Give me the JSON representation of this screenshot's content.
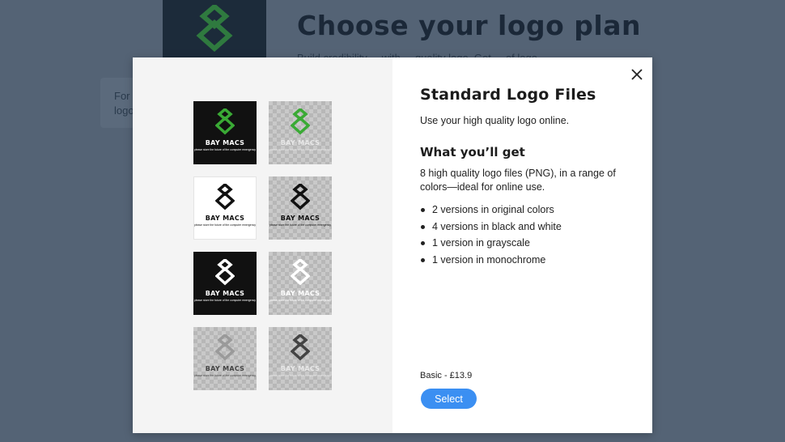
{
  "page": {
    "title": "Choose your logo plan",
    "subtitle": "Build credibility ... with ... quality logo. Get ... of logo ...",
    "side_card_text": "For a\nlogo"
  },
  "modal": {
    "plan_title": "Standard Logo Files",
    "plan_description": "Use your high quality logo online.",
    "section_title": "What you’ll get",
    "section_description": "8 high quality logo files (PNG), in a range of colors—ideal for online use.",
    "features": [
      "2 versions in original colors",
      "4 versions in black and white",
      "1 version in grayscale",
      "1 version in monochrome"
    ],
    "price_label": "Basic - £13.9",
    "select_label": "Select",
    "close_icon": "close-icon"
  },
  "logo_preview": {
    "brand_name": "BAY MACS",
    "tagline": "please store the future of the computer emergency",
    "tiles": [
      {
        "variant": "original-dark",
        "background": "#111111",
        "mark": "#3aaa35",
        "text": "white"
      },
      {
        "variant": "original-transparent",
        "background": "transparent",
        "mark": "#3aaa35",
        "text": "lightgray"
      },
      {
        "variant": "black-on-white",
        "background": "#ffffff",
        "mark": "#111111",
        "text": "black"
      },
      {
        "variant": "black-transparent",
        "background": "transparent",
        "mark": "#111111",
        "text": "black"
      },
      {
        "variant": "white-on-black",
        "background": "#111111",
        "mark": "#ffffff",
        "text": "white"
      },
      {
        "variant": "white-transparent",
        "background": "transparent",
        "mark": "#ffffff",
        "text": "white"
      },
      {
        "variant": "grayscale",
        "background": "transparent",
        "mark": "#9a9a9a",
        "text": "dgray"
      },
      {
        "variant": "monochrome",
        "background": "transparent",
        "mark": "#444444",
        "text": "lightgray"
      }
    ]
  },
  "colors": {
    "backdrop": "#546375",
    "accent_button": "#3b8ff2",
    "brand_green": "#3aaa35"
  }
}
